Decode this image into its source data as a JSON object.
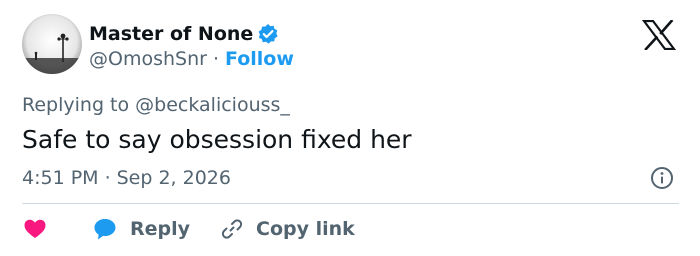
{
  "author": {
    "display_name": "Master of None",
    "handle": "@OmoshSnr",
    "separator": "·",
    "follow_label": "Follow",
    "verified": true
  },
  "tweet": {
    "replying_prefix": "Replying to ",
    "replying_to": "@beckaliciouss_",
    "text": "Safe to say obsession fixed her",
    "time": "4:51 PM",
    "date_separator": "·",
    "date": "Sep 2, 2026"
  },
  "actions": {
    "reply_label": "Reply",
    "copy_link_label": "Copy link"
  },
  "icons": {
    "verified": "verified-badge-icon",
    "logo": "x-logo-icon",
    "info": "info-icon",
    "like": "heart-icon",
    "reply": "speech-bubble-icon",
    "copy": "link-icon"
  },
  "colors": {
    "accent": "#1d9bf0",
    "like": "#f91880",
    "muted_text": "#536471",
    "text": "#0f1419",
    "divider": "#cfd9de"
  }
}
